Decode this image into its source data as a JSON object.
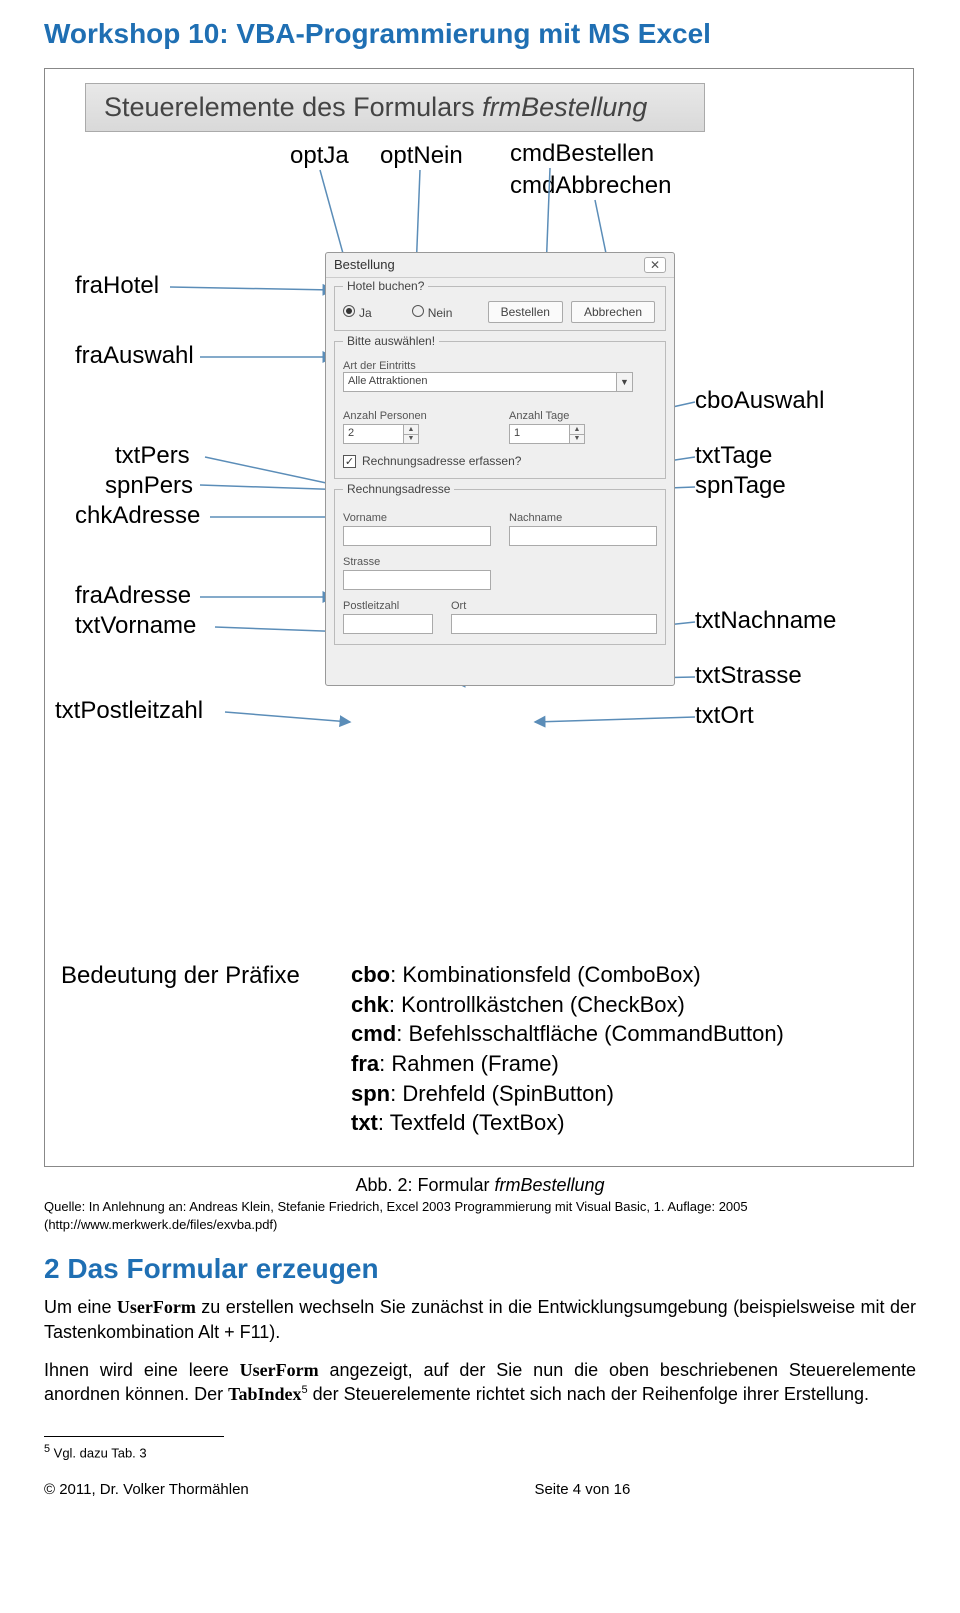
{
  "header": {
    "title": "Workshop 10: VBA-Programmierung mit MS Excel"
  },
  "slide": {
    "title_pre": "Steuerelemente des Formulars ",
    "title_it": "frmBestellung",
    "labels": {
      "optJa": "optJa",
      "optNein": "optNein",
      "cmdBestellen": "cmdBestellen",
      "cmdAbbrechen": "cmdAbbrechen",
      "fraHotel": "fraHotel",
      "fraAuswahl": "fraAuswahl",
      "txtPers": "txtPers",
      "spnPers": "spnPers",
      "chkAdresse": "chkAdresse",
      "fraAdresse": "fraAdresse",
      "txtVorname": "txtVorname",
      "txtPostleitzahl": "txtPostleitzahl",
      "cboAuswahl": "cboAuswahl",
      "txtTage": "txtTage",
      "spnTage": "spnTage",
      "txtNachname": "txtNachname",
      "txtStrasse": "txtStrasse",
      "txtOrt": "txtOrt"
    },
    "win": {
      "title": "Bestellung",
      "close": "✕",
      "frameHotel": "Hotel buchen?",
      "ja": "Ja",
      "nein": "Nein",
      "bestellen": "Bestellen",
      "abbrechen": "Abbrechen",
      "frameAuswahl": "Bitte auswählen!",
      "artLabel": "Art der Eintritts",
      "comboValue": "Alle Attraktionen",
      "anzPers": "Anzahl Personen",
      "anzTage": "Anzahl Tage",
      "persVal": "2",
      "tageVal": "1",
      "chkText": "Rechnungsadresse erfassen?",
      "frameAdresse": "Rechnungsadresse",
      "vorname": "Vorname",
      "nachname": "Nachname",
      "strasse": "Strasse",
      "plz": "Postleitzahl",
      "ort": "Ort"
    },
    "prefix_title": "Bedeutung der Präfixe",
    "prefixes": {
      "cbo_b": "cbo",
      "cbo_t": ": Kombinationsfeld (ComboBox)",
      "chk_b": "chk",
      "chk_t": ": Kontrollkästchen (CheckBox)",
      "cmd_b": "cmd",
      "cmd_t": ": Befehlsschaltfläche (CommandButton)",
      "fra_b": "fra",
      "fra_t": ": Rahmen (Frame)",
      "spn_b": "spn",
      "spn_t": ": Drehfeld (SpinButton)",
      "txt_b": "txt",
      "txt_t": ": Textfeld (TextBox)"
    }
  },
  "caption": {
    "pre": "Abb. 2: Formular ",
    "it": "frmBestellung"
  },
  "quelle": "Quelle: In Anlehnung an: Andreas Klein, Stefanie Friedrich, Excel 2003 Programmierung mit Visual Basic, 1. Auflage: 2005 (http://www.merkwerk.de/files/exvba.pdf)",
  "section2": {
    "heading": "2 Das Formular erzeugen",
    "p1_a": "Um eine ",
    "p1_code1": "UserForm",
    "p1_b": " zu erstellen wechseln Sie zunächst in die Entwicklungsumgebung (beispielsweise mit der Tastenkombination Alt + F11).",
    "p2_a": "Ihnen wird eine leere ",
    "p2_code1": "UserForm",
    "p2_b": " angezeigt, auf der Sie nun die oben beschriebenen Steuerelemente anordnen können. Der ",
    "p2_code2": "TabIndex",
    "p2_sup": "5",
    "p2_c": " der Steuerelemente richtet sich nach der Reihenfolge ihrer Erstellung."
  },
  "footnote": {
    "marker": "5",
    "text": " Vgl. dazu Tab. 3"
  },
  "footer": {
    "left": "© 2011, Dr. Volker Thormählen",
    "mid": "Seite 4 von 16"
  }
}
